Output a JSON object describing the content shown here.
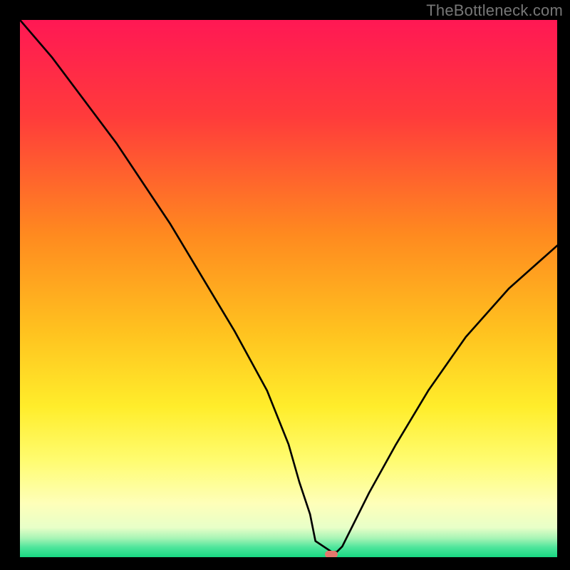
{
  "watermark": "TheBottleneck.com",
  "chart_data": {
    "type": "line",
    "title": "",
    "xlabel": "",
    "ylabel": "",
    "xlim": [
      0,
      100
    ],
    "ylim": [
      0,
      100
    ],
    "gradient_stops": [
      {
        "offset": 0.0,
        "color": "#ff1854"
      },
      {
        "offset": 0.18,
        "color": "#ff3b3b"
      },
      {
        "offset": 0.4,
        "color": "#ff8a1f"
      },
      {
        "offset": 0.58,
        "color": "#ffc21f"
      },
      {
        "offset": 0.72,
        "color": "#ffed2b"
      },
      {
        "offset": 0.82,
        "color": "#fffc70"
      },
      {
        "offset": 0.9,
        "color": "#feffb9"
      },
      {
        "offset": 0.945,
        "color": "#e8ffc8"
      },
      {
        "offset": 0.965,
        "color": "#a6f4b5"
      },
      {
        "offset": 0.982,
        "color": "#4de59b"
      },
      {
        "offset": 1.0,
        "color": "#18d882"
      }
    ],
    "series": [
      {
        "name": "bottleneck-curve",
        "x": [
          0,
          6,
          12,
          18,
          22,
          28,
          34,
          40,
          46,
          50,
          52,
          54,
          55,
          58,
          59,
          60,
          62,
          65,
          70,
          76,
          83,
          91,
          100
        ],
        "y": [
          100,
          93,
          85,
          77,
          71,
          62,
          52,
          42,
          31,
          21,
          14,
          8,
          3,
          1,
          1,
          2,
          6,
          12,
          21,
          31,
          41,
          50,
          58
        ]
      }
    ],
    "marker": {
      "x": 58,
      "y": 0.5,
      "color": "#e4776d"
    }
  }
}
